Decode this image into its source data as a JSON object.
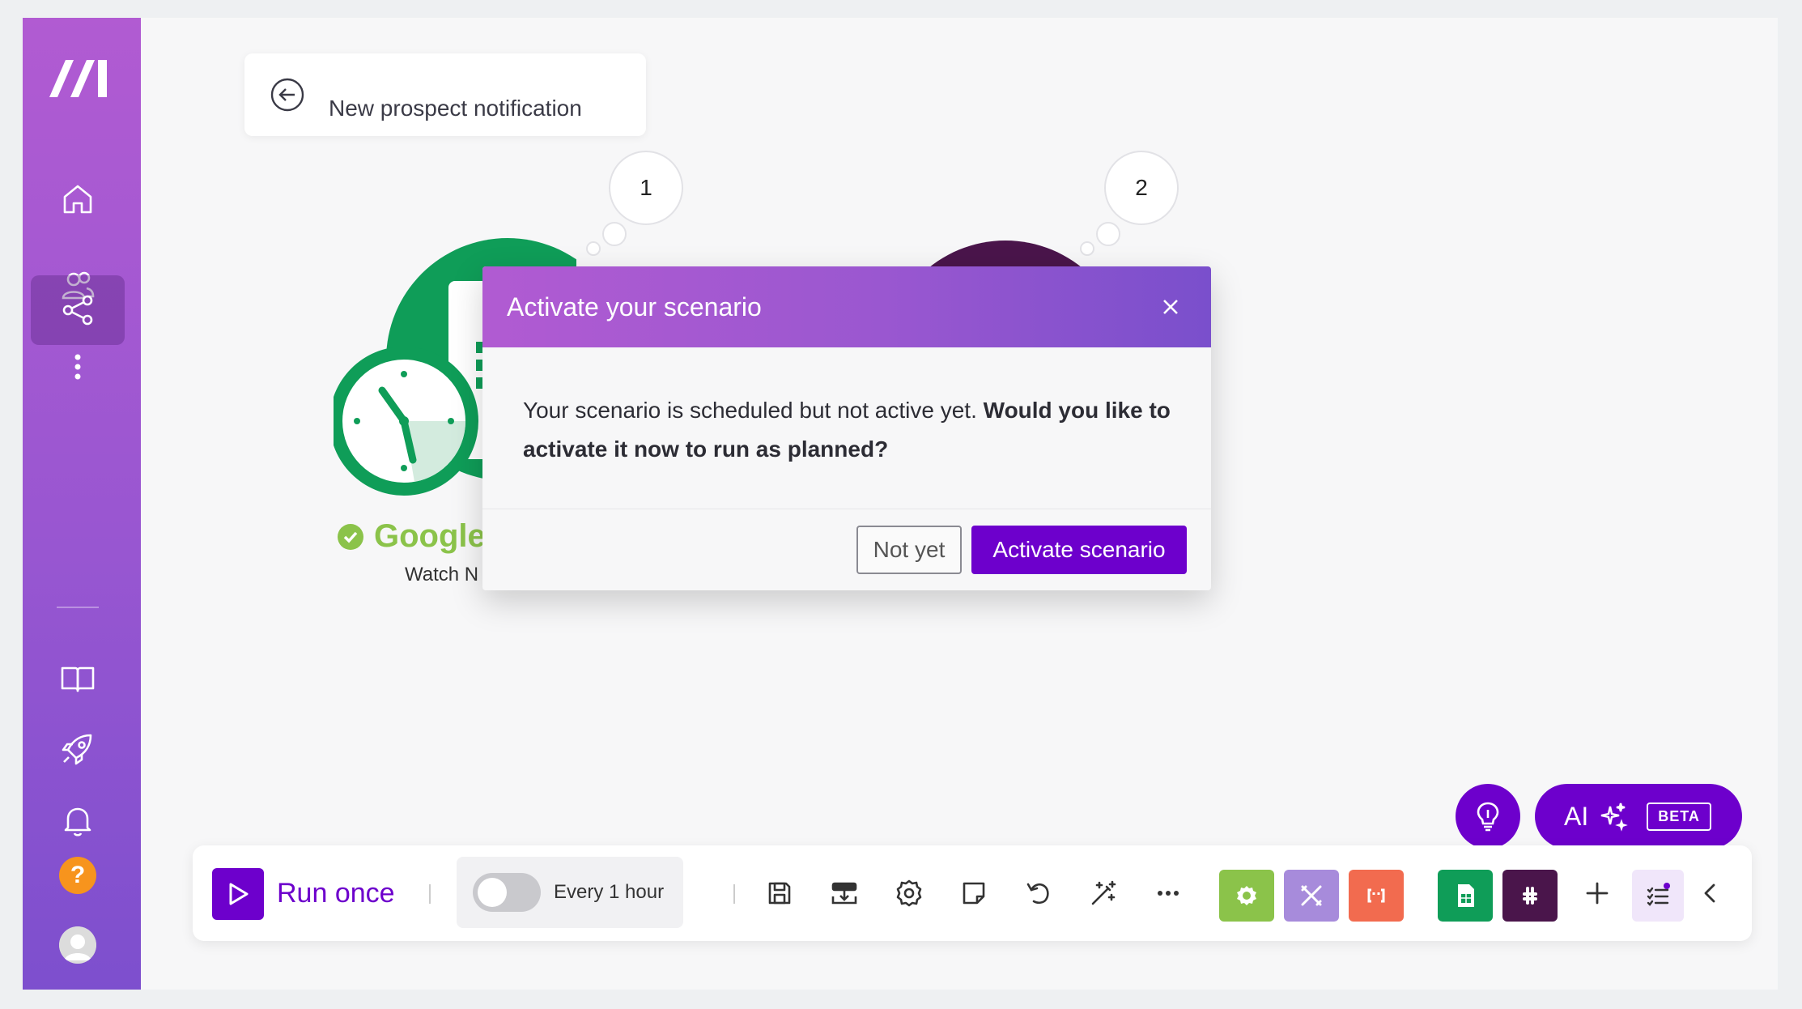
{
  "scenario": {
    "name": "New prospect notification"
  },
  "sidebar": {
    "items": [
      {
        "name": "home-icon"
      },
      {
        "name": "team-icon"
      },
      {
        "name": "scenarios-icon",
        "active": true
      },
      {
        "name": "more-icon"
      },
      {
        "name": "docs-icon"
      },
      {
        "name": "rocket-icon"
      },
      {
        "name": "bell-icon"
      },
      {
        "name": "help-icon",
        "label": "?"
      },
      {
        "name": "avatar-icon"
      }
    ]
  },
  "canvas": {
    "modules": [
      {
        "bubble": "1",
        "app": "Google",
        "action": "Watch N",
        "color": "#0f9d58"
      },
      {
        "bubble": "2",
        "color": "#4a154b"
      }
    ]
  },
  "modal": {
    "title": "Activate your scenario",
    "body_plain": "Your scenario is scheduled but not active yet. ",
    "body_bold": "Would you like to activate it now to run as planned?",
    "secondary_label": "Not yet",
    "primary_label": "Activate scenario"
  },
  "toolbar": {
    "run_label": "Run once",
    "schedule_label": "Every 1 hour",
    "schedule_active": false,
    "icons": [
      "save-icon",
      "blueprint-icon",
      "settings-icon",
      "notes-icon",
      "undo-icon",
      "auto-align-icon",
      "more-icon"
    ],
    "apps": [
      {
        "name": "tools-gear-app",
        "color": "#8bc34a"
      },
      {
        "name": "flow-control-app",
        "color": "#a78bdb"
      },
      {
        "name": "text-parser-app",
        "color": "#f26b4f"
      },
      {
        "name": "google-sheets-app",
        "color": "#0f9d58"
      },
      {
        "name": "slack-app",
        "color": "#4a154b"
      }
    ]
  },
  "ai": {
    "label": "AI",
    "badge": "BETA"
  },
  "colors": {
    "primary": "#6d00cc",
    "sidebar_top": "#b15bd2",
    "sidebar_bottom": "#7d4fce"
  }
}
